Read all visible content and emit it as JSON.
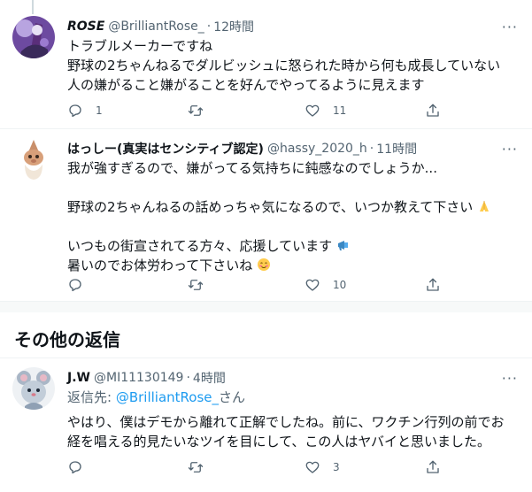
{
  "tweets": [
    {
      "name": "ROSE",
      "handle": "@BrilliantRose_",
      "time": "12時間",
      "lines": [
        "トラブルメーカーですね",
        "野球の2ちゃんねるでダルビッシュに怒られた時から何も成長していない",
        "人の嫌がること嫌がることを好んでやってるように見えます"
      ],
      "reply_count": "1",
      "retweet_count": "",
      "like_count": "11"
    },
    {
      "name": "はっしー(真実はセンシティブ認定)",
      "handle": "@hassy_2020_h",
      "time": "11時間",
      "lines": [
        "我が強すぎるので、嫌がってる気持ちに鈍感なのでしょうか...",
        "",
        "野球の2ちゃんねるの話めっちゃ気になるので、いつか教えて下さい",
        "",
        "いつもの街宣されてる方々、応援しています",
        "暑いのでお体労わって下さいね"
      ],
      "reply_count": "",
      "retweet_count": "",
      "like_count": "10"
    },
    {
      "name": "J.W",
      "handle": "@MI11130149",
      "time": "4時間",
      "reply_to_prefix": "返信先: ",
      "reply_to_handle": "@BrilliantRose_",
      "reply_to_suffix": "さん",
      "lines": [
        "やはり、僕はデモから離れて正解でしたね。前に、ワクチン行列の前でお",
        "経を唱える的見たいなツイを目にして、この人はヤバイと思いました。"
      ],
      "reply_count": "",
      "retweet_count": "",
      "like_count": "3"
    }
  ],
  "section": {
    "title": "その他の返信"
  },
  "icons": {
    "reply": "reply-icon",
    "retweet": "retweet-icon",
    "like": "heart-icon",
    "share": "share-icon",
    "more": "more-icon"
  },
  "colors": {
    "link": "#1d9bf0",
    "secondary": "#536471",
    "divider": "#eff3f4"
  }
}
